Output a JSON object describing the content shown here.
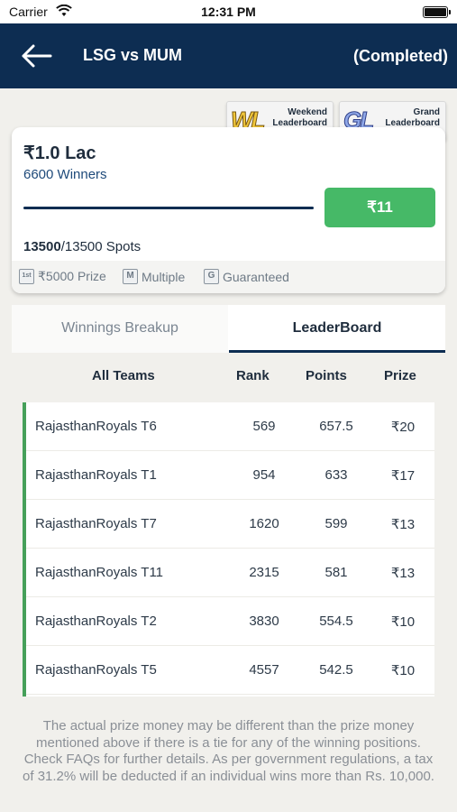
{
  "status_bar": {
    "carrier": "Carrier",
    "time": "12:31 PM"
  },
  "header": {
    "title": "LSG vs MUM",
    "status": "(Completed)"
  },
  "badges": {
    "weekend": {
      "logo": "WL",
      "line1": "Weekend",
      "line2": "Leaderboard"
    },
    "grand": {
      "logo": "GL",
      "line1": "Grand",
      "line2": "Leaderboard"
    }
  },
  "contest": {
    "prize_pool": "₹1.0 Lac",
    "winners": "6600 Winners",
    "entry_fee": "₹11",
    "spots_filled": "13500",
    "spots_total": "/13500 Spots",
    "fill_fraction": 1.0,
    "features": {
      "first_icon": "1st",
      "first_label": "₹5000 Prize",
      "multiple_icon": "M",
      "multiple_label": "Multiple",
      "guaranteed_icon": "G",
      "guaranteed_label": "Guaranteed"
    }
  },
  "tabs": {
    "breakup": "Winnings Breakup",
    "leaderboard": "LeaderBoard"
  },
  "columns": {
    "team": "All Teams",
    "rank": "Rank",
    "points": "Points",
    "prize": "Prize"
  },
  "rows": [
    {
      "team": "RajasthanRoyals  T6",
      "rank": "569",
      "points": "657.5",
      "prize": "₹20"
    },
    {
      "team": "RajasthanRoyals  T1",
      "rank": "954",
      "points": "633",
      "prize": "₹17"
    },
    {
      "team": "RajasthanRoyals  T7",
      "rank": "1620",
      "points": "599",
      "prize": "₹13"
    },
    {
      "team": "RajasthanRoyals  T11",
      "rank": "2315",
      "points": "581",
      "prize": "₹13"
    },
    {
      "team": "RajasthanRoyals  T2",
      "rank": "3830",
      "points": "554.5",
      "prize": "₹10"
    },
    {
      "team": "RajasthanRoyals  T5",
      "rank": "4557",
      "points": "542.5",
      "prize": "₹10"
    }
  ],
  "disclaimer": "The actual prize money may be different than the prize money mentioned above if there is a tie for any of the winning positions. Check FAQs for further details. As per government regulations, a tax of 31.2% will be deducted if an individual wins more than Rs. 10,000."
}
